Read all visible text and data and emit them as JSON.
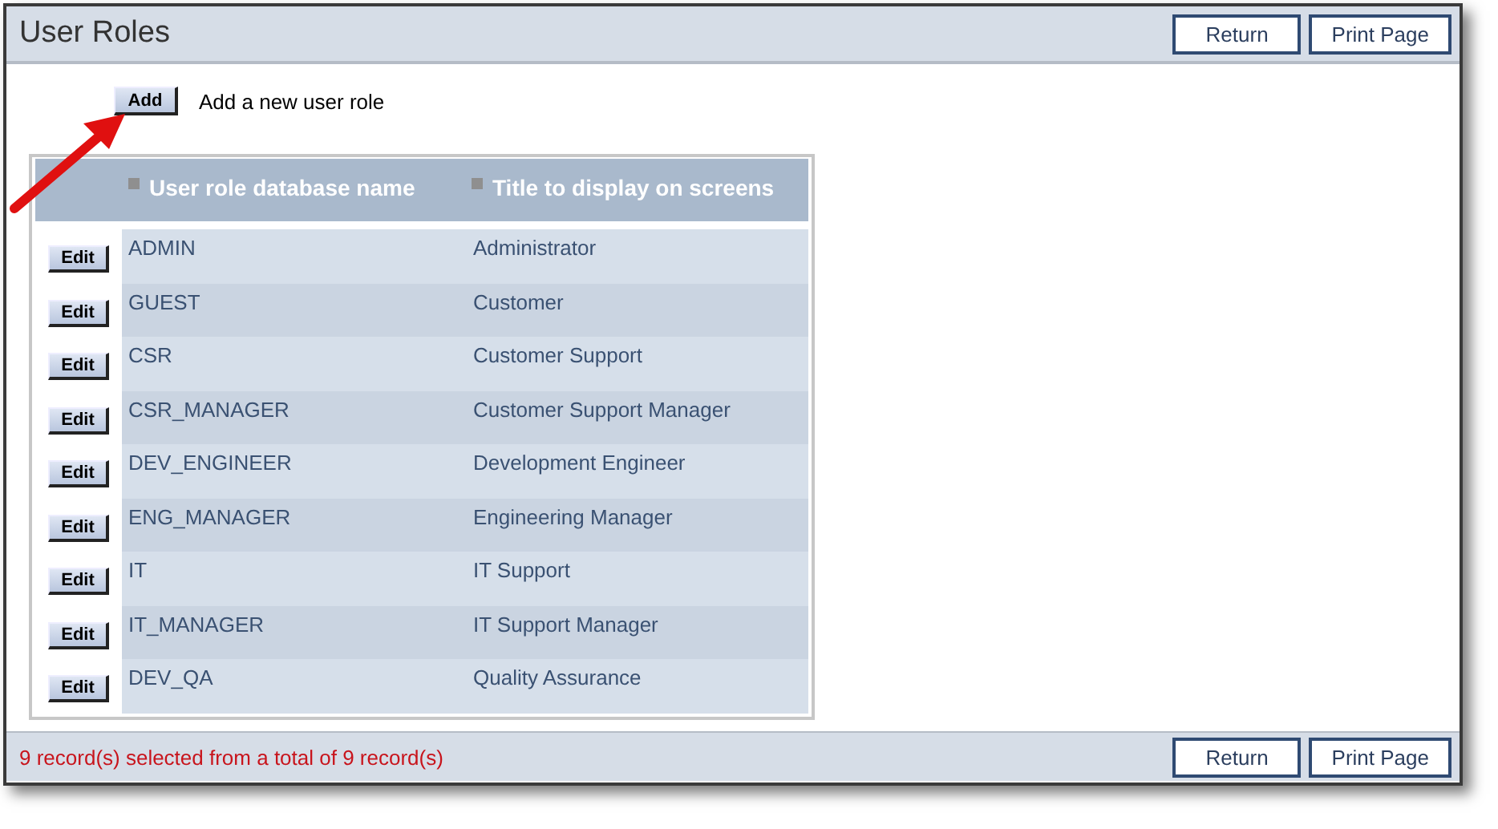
{
  "page": {
    "title": "User Roles"
  },
  "header_buttons": [
    "Return",
    "Print Page"
  ],
  "add": {
    "button": "Add",
    "description": "Add a new user role"
  },
  "table": {
    "columns": [
      "User role database name",
      "Title to display on screens"
    ],
    "rows": [
      {
        "button": "Edit",
        "name": "ADMIN",
        "title": "Administrator"
      },
      {
        "button": "Edit",
        "name": "GUEST",
        "title": "Customer"
      },
      {
        "button": "Edit",
        "name": "CSR",
        "title": "Customer Support"
      },
      {
        "button": "Edit",
        "name": "CSR_MANAGER",
        "title": "Customer Support Manager"
      },
      {
        "button": "Edit",
        "name": "DEV_ENGINEER",
        "title": "Development Engineer"
      },
      {
        "button": "Edit",
        "name": "ENG_MANAGER",
        "title": "Engineering Manager"
      },
      {
        "button": "Edit",
        "name": "IT",
        "title": "IT Support"
      },
      {
        "button": "Edit",
        "name": "IT_MANAGER",
        "title": "IT Support Manager"
      },
      {
        "button": "Edit",
        "name": "DEV_QA",
        "title": "Quality Assurance"
      }
    ]
  },
  "footer": {
    "status": "9 record(s) selected from a total of 9 record(s)",
    "buttons": [
      "Return",
      "Print Page"
    ]
  }
}
